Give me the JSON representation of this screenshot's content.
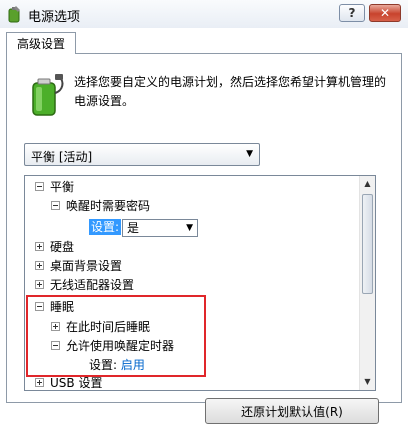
{
  "window": {
    "title": "电源选项",
    "help_label": "?",
    "close_label": "✕"
  },
  "tab": {
    "label": "高级设置"
  },
  "description": "选择您要自定义的电源计划，然后选择您希望计算机管理的电源设置。",
  "plan_select": {
    "value": "平衡 [活动]"
  },
  "tree": {
    "root": "平衡",
    "wake_password": "唤醒时需要密码",
    "wake_password_setting_label": "设置:",
    "wake_password_value": "是",
    "hard_disk": "硬盘",
    "desktop_background": "桌面背景设置",
    "wireless_adapter": "无线适配器设置",
    "sleep": "睡眠",
    "sleep_after": "在此时间后睡眠",
    "allow_wake_timers": "允许使用唤醒定时器",
    "wake_timers_setting_label": "设置:",
    "wake_timers_value": "启用",
    "usb": "USB 设置"
  },
  "buttons": {
    "restore_defaults": "还原计划默认值(R)"
  },
  "colors": {
    "highlight_box": "#e0262a",
    "selection": "#3399ff",
    "link": "#0066cc"
  }
}
